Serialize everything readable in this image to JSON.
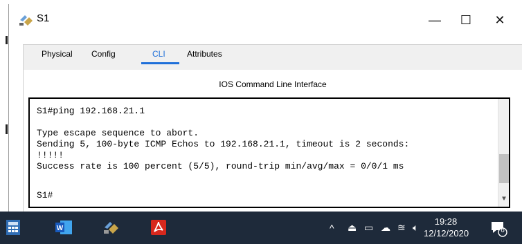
{
  "window": {
    "title": "S1",
    "controls": {
      "minimize": "—",
      "maximize": "☐",
      "close": "✕"
    }
  },
  "tabs": [
    {
      "label": "Physical"
    },
    {
      "label": "Config"
    },
    {
      "label": "CLI"
    },
    {
      "label": "Attributes"
    }
  ],
  "active_tab": "CLI",
  "panel": {
    "title": "IOS Command Line Interface"
  },
  "console": {
    "lines": [
      "S1#ping 192.168.21.1",
      "",
      "Type escape sequence to abort.",
      "Sending 5, 100-byte ICMP Echos to 192.168.21.1, timeout is 2 seconds:",
      "!!!!!",
      "Success rate is 100 percent (5/5), round-trip min/avg/max = 0/0/1 ms",
      "",
      "S1#"
    ]
  },
  "taskbar": {
    "time": "19:28",
    "date": "12/12/2020",
    "notification_count": "6",
    "icons": [
      "calculator-icon",
      "word-icon",
      "packet-tracer-icon",
      "acrobat-icon"
    ]
  },
  "colors": {
    "accent": "#1e6fd9",
    "taskbar": "#1e2a3a"
  }
}
